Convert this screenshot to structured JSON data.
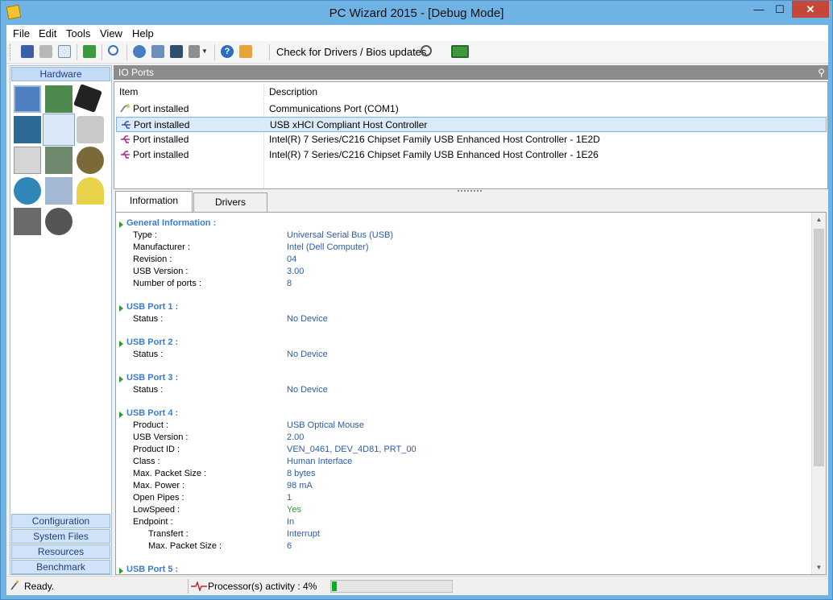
{
  "window": {
    "title": "PC Wizard 2015 - [Debug Mode]",
    "minimize": "—",
    "maximize": "☐",
    "close": "✕"
  },
  "menu": [
    "File",
    "Edit",
    "Tools",
    "View",
    "Help"
  ],
  "toolbar": {
    "icons": [
      "save-icon",
      "print-icon",
      "copy-icon",
      "refresh-icon",
      "search-icon",
      "network-icon",
      "chip-icon",
      "cpu-icon",
      "module-dropdown-icon",
      "help-icon",
      "home-icon"
    ],
    "check_label": "Check for Drivers / Bios updates"
  },
  "left_panel": {
    "active_category": "Hardware",
    "categories": [
      "Configuration",
      "System Files",
      "Resources",
      "Benchmark"
    ],
    "hardware_icons": [
      "system-icon",
      "motherboard-icon",
      "processor-icon",
      "video-icon",
      "io-ports-icon",
      "drives-icon",
      "printers-icon",
      "devices-icon",
      "audio-icon",
      "network-icon",
      "plug-icon",
      "power-icon",
      "peripherals-icon",
      "gauge-icon"
    ]
  },
  "list": {
    "header": "IO Ports",
    "columns": [
      "Item",
      "Description"
    ],
    "rows": [
      {
        "item": "Port installed",
        "description": "Communications Port (COM1)",
        "selected": false
      },
      {
        "item": "Port installed",
        "description": "USB xHCI Compliant Host Controller",
        "selected": true
      },
      {
        "item": "Port installed",
        "description": "Intel(R) 7 Series/C216 Chipset Family USB Enhanced Host Controller - 1E2D",
        "selected": false
      },
      {
        "item": "Port installed",
        "description": "Intel(R) 7 Series/C216 Chipset Family USB Enhanced Host Controller - 1E26",
        "selected": false
      }
    ]
  },
  "tabs": [
    "Information",
    "Drivers"
  ],
  "details": {
    "general": {
      "title": "General Information :",
      "props": [
        {
          "label": "Type :",
          "value": "Universal Serial Bus (USB)"
        },
        {
          "label": "Manufacturer :",
          "value": "Intel  (Dell Computer)"
        },
        {
          "label": "Revision :",
          "value": "04"
        },
        {
          "label": "USB Version :",
          "value": "3.00"
        },
        {
          "label": "Number of ports :",
          "value": "8"
        }
      ]
    },
    "port1": {
      "title": "USB Port 1 :",
      "status_label": "Status :",
      "status": "No Device"
    },
    "port2": {
      "title": "USB Port 2 :",
      "status_label": "Status :",
      "status": "No Device"
    },
    "port3": {
      "title": "USB Port 3 :",
      "status_label": "Status :",
      "status": "No Device"
    },
    "port4": {
      "title": "USB Port 4 :",
      "props": [
        {
          "label": "Product :",
          "value": "USB Optical Mouse"
        },
        {
          "label": "USB Version :",
          "value": "2.00"
        },
        {
          "label": "Product ID :",
          "value": "VEN_0461, DEV_4D81, PRT_00"
        },
        {
          "label": "Class :",
          "value": "Human Interface"
        },
        {
          "label": "Max. Packet Size :",
          "value": "8 bytes"
        },
        {
          "label": "Max. Power :",
          "value": "98 mA"
        },
        {
          "label": "Open Pipes :",
          "value": "1"
        },
        {
          "label": "LowSpeed :",
          "value": "Yes"
        },
        {
          "label": "Endpoint :",
          "value": "In"
        },
        {
          "label": "Transfert :",
          "value": "Interrupt"
        },
        {
          "label": "Max. Packet Size :",
          "value": "6"
        }
      ]
    },
    "port5": {
      "title": "USB Port 5 :"
    }
  },
  "status": {
    "ready": "Ready.",
    "activity_label": "Processor(s) activity : 4%",
    "activity_fraction": 0.04
  }
}
